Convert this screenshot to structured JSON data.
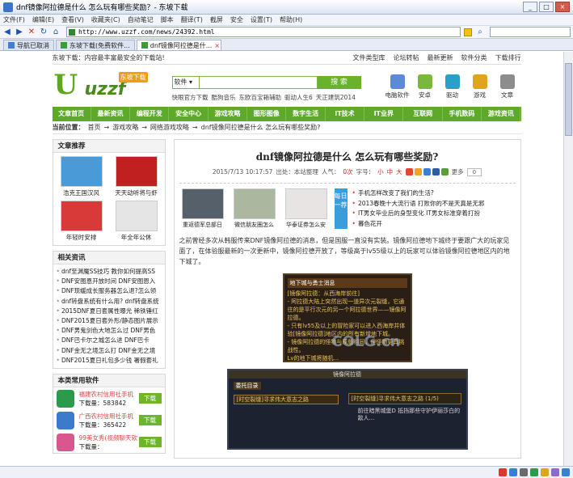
{
  "window": {
    "title": "dnf镜像阿拉德是什么 怎么玩有哪些奖励？- 东坡下载"
  },
  "menu": [
    "文件(F)",
    "编辑(E)",
    "查看(V)",
    "收藏夹(C)",
    "自动笔记",
    "脚本",
    "翻译(T)",
    "截屏",
    "安全",
    "设置(T)",
    "帮助(H)"
  ],
  "address": {
    "url": "http://www.uzzf.com/news/24392.html"
  },
  "tabs": [
    {
      "label": "导航已取消"
    },
    {
      "label": "东坡下载(免费软件..."
    },
    {
      "label": "dnf镜像阿拉德是什..."
    }
  ],
  "site": {
    "tagline": "东坡下载：内容最丰富最安全的下载站!",
    "toplinks": [
      "文件类型库",
      "论坛转帖",
      "最新更新",
      "软件分类",
      "下载排行"
    ],
    "logo_text": "uzzf",
    "logo_badge": "东坡下载",
    "search_select": "软件 ▾",
    "search_btn": "搜 索",
    "hotwords": [
      "快眼官方下载",
      "酷狗音乐",
      "东欧百宝箱辅助",
      "驱动人生6",
      "天正建筑2014"
    ],
    "header_icons": [
      {
        "label": "电脑软件",
        "color": "#5b8bd6"
      },
      {
        "label": "安卓",
        "color": "#7ab83a"
      },
      {
        "label": "驱动",
        "color": "#2aa0c8"
      },
      {
        "label": "游戏",
        "color": "#e0a51e"
      },
      {
        "label": "文章",
        "color": "#8c8c8c"
      }
    ],
    "nav": [
      "文章首页",
      "最新资讯",
      "编程开发",
      "安全中心",
      "游戏攻略",
      "图形图像",
      "数字生活",
      "IT技术",
      "IT业界",
      "互联网",
      "手机数码",
      "游戏资讯"
    ]
  },
  "crumb": {
    "label": "当前位置：",
    "items": [
      "首页",
      "→",
      "游戏攻略",
      "→",
      "网络游戏攻略",
      "→",
      "dnf镜像阿拉德是什么 怎么玩有哪些奖励?"
    ]
  },
  "sidebar": {
    "rec_title": "文章推荐",
    "rec": [
      {
        "label": "浩克王国汉风",
        "color": "#4a9ad8"
      },
      {
        "label": "天天动听将与虾",
        "color": "#c02020"
      },
      {
        "label": "年轻时安排",
        "color": "#d83a3a"
      },
      {
        "label": "年全年公休",
        "color": "#e5e5e5"
      }
    ],
    "news_title": "相关资讯",
    "news": [
      "dnf至渊魔SS技巧 教你如何提高SS",
      "DNF安图恩开放时间 DNF安图恩入",
      "DNF现缓成长服务器怎么退?怎么领",
      "dnf转盘系统有什么用? dnf转盘系统",
      "2015DNF夏日套属性曝光 稀铁锤红",
      "DNF2015夏日套外形/静态图片展示",
      "DNF男鬼剑色大地怎么过 DNF男色",
      "DNF巴卡尔之城怎么进 DNF巴卡",
      "DNF金无之境怎么打 DNF金无之境",
      "DNF2015夏日礼包多少钱 署假套礼"
    ],
    "soft_title": "本类常用软件",
    "soft": [
      {
        "name": "福建农村信用社手机",
        "dl_label": "下载量：",
        "downloads": "583842",
        "btn": "下载",
        "color": "#2a9b4a"
      },
      {
        "name": "广西农村信用社手机",
        "dl_label": "下载量：",
        "downloads": "365422",
        "btn": "下载",
        "color": "#3b7bc9"
      },
      {
        "name": "99美女秀(视频聊天软",
        "dl_label": "下载量：",
        "downloads": "",
        "btn": "下载",
        "color": "#d9568f"
      }
    ]
  },
  "article": {
    "title": "dnf镜像阿拉德是什么 怎么玩有哪些奖励?",
    "date": "2015/7/13 10:17:57",
    "source": "出处：本站整理",
    "views_label": "人气：",
    "views": "0次",
    "font_label": "字号：",
    "font_small": "小",
    "font_mid": "中",
    "font_big": "大",
    "more": "更多",
    "count": "0",
    "promo": [
      {
        "label": "重返德军总部日",
        "color": "#55606a"
      },
      {
        "label": "微信朋友圈怎么",
        "color": "#aab8a0"
      },
      {
        "label": "华泰证券怎么安",
        "color": "#e9e4e4"
      }
    ],
    "daily": "每日一荐",
    "plinks": [
      "手机怎样改变了我们的生活?",
      "2013春晚十大流行语 打败你的不是天真是无邪",
      "IT男女毕业后的身型变化 IT男女标准穿着打扮",
      "暮色花开"
    ],
    "body": "之前曾经多次从韩服传来DNF镜像阿拉德的消息，但是国服一直没有实装。镜像阿拉德地下城终于要跟广大的玩家见面了，在体验服最新的一次更新中，镜像阿拉德开放了，等级高于lv55级以上的玩家可以体验镜像阿拉德地区内的地下城了。",
    "img1": {
      "title": "地下城与勇士消息",
      "lines": [
        "[镜像阿拉德：从西海岸前往]",
        "- 阿拉德大陆上突然出现一道异次元裂缝，它通往的是平行次元的另一个阿拉德世界——镜像阿拉德。",
        "- 只有lv55及以上的冒险家可以进入西海岸并体验[镜像阿拉德]地区内的所有新增地下城。",
        "- 镜像阿拉德的怪物与原版相同，但怪物更具挑战性。",
        "Lv的地下城将随机..."
      ],
      "watermark": "COLG.cn"
    },
    "img2": {
      "bar": "镜像阿拉德",
      "tab": "委托目录",
      "row1": "[时空裂缝]寻求伟大意志之路",
      "row2": "[时空裂缝]寻求伟大意志之路 (1/5)",
      "desc": "前往暗黑城堡D 抵挡那些守护伊丽莎白的敌人..."
    }
  }
}
